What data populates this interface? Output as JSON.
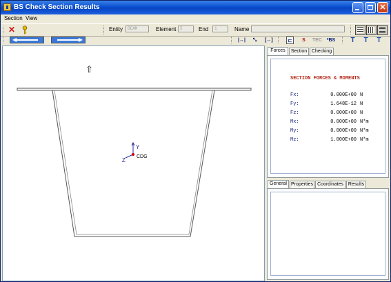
{
  "window": {
    "title": "BS Check Section Results"
  },
  "menu": {
    "items": [
      "Section",
      "View"
    ]
  },
  "toolbar": {
    "entity_label": "Entity",
    "entity_value": "BEAM",
    "element_label": "Element",
    "element_value": "5",
    "end_label": "End",
    "end_value": "1",
    "name_label": "Name",
    "name_value": ""
  },
  "toolbar2": {
    "tec_label": "TEC",
    "bs_label": "*BS"
  },
  "canvas": {
    "up_arrow": "⇧",
    "axis_y": "Y",
    "axis_z": "Z",
    "cog_label": "CDG"
  },
  "right_top_tabs": [
    "Forces",
    "Section",
    "Checking"
  ],
  "right_bottom_tabs": [
    "General",
    "Properties",
    "Coordinates",
    "Results"
  ],
  "forces": {
    "title": "SECTION FORCES & MOMENTS",
    "rows": [
      {
        "label": "Fx:",
        "value": "0.000E+00",
        "unit": "N"
      },
      {
        "label": "Fy:",
        "value": "1.648E-12",
        "unit": "N"
      },
      {
        "label": "Fz:",
        "value": "0.000E+00",
        "unit": "N"
      },
      {
        "label": "Mx:",
        "value": "0.000E+00",
        "unit": "N*m"
      },
      {
        "label": "My:",
        "value": "0.000E+00",
        "unit": "N*m"
      },
      {
        "label": "Mz:",
        "value": "1.000E+00",
        "unit": "N*m"
      }
    ]
  }
}
